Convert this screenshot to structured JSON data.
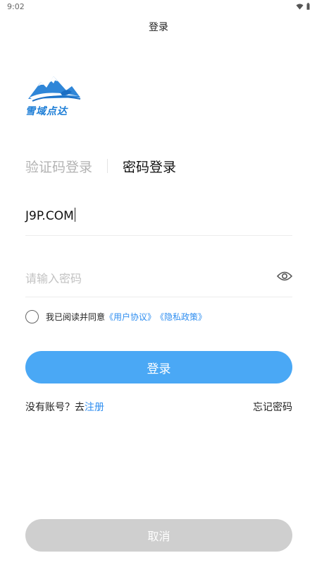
{
  "status_bar": {
    "time": "9:02",
    "icons": [
      "wifi-icon",
      "battery-icon"
    ]
  },
  "header": {
    "title": "登录"
  },
  "logo": {
    "text": "雪域点达"
  },
  "tabs": [
    {
      "label": "验证码登录",
      "active": false
    },
    {
      "label": "密码登录",
      "active": true
    }
  ],
  "form": {
    "account_value": "J9P.COM",
    "password_placeholder": "请输入密码",
    "password_toggle_icon": "eye-icon"
  },
  "agreement": {
    "checked": false,
    "text": "我已阅读并同意",
    "user_agreement": "《用户协议》",
    "privacy_policy": "《隐私政策》"
  },
  "login_button": "登录",
  "links": {
    "no_account": "没有账号？去",
    "register": "注册",
    "forgot_password": "忘记密码"
  },
  "cancel_button": "取消",
  "colors": {
    "accent": "#4aa8f5",
    "link": "#2f8ef0",
    "cancel_bg": "#cfcfcf",
    "brand": "#1c7dd6"
  }
}
